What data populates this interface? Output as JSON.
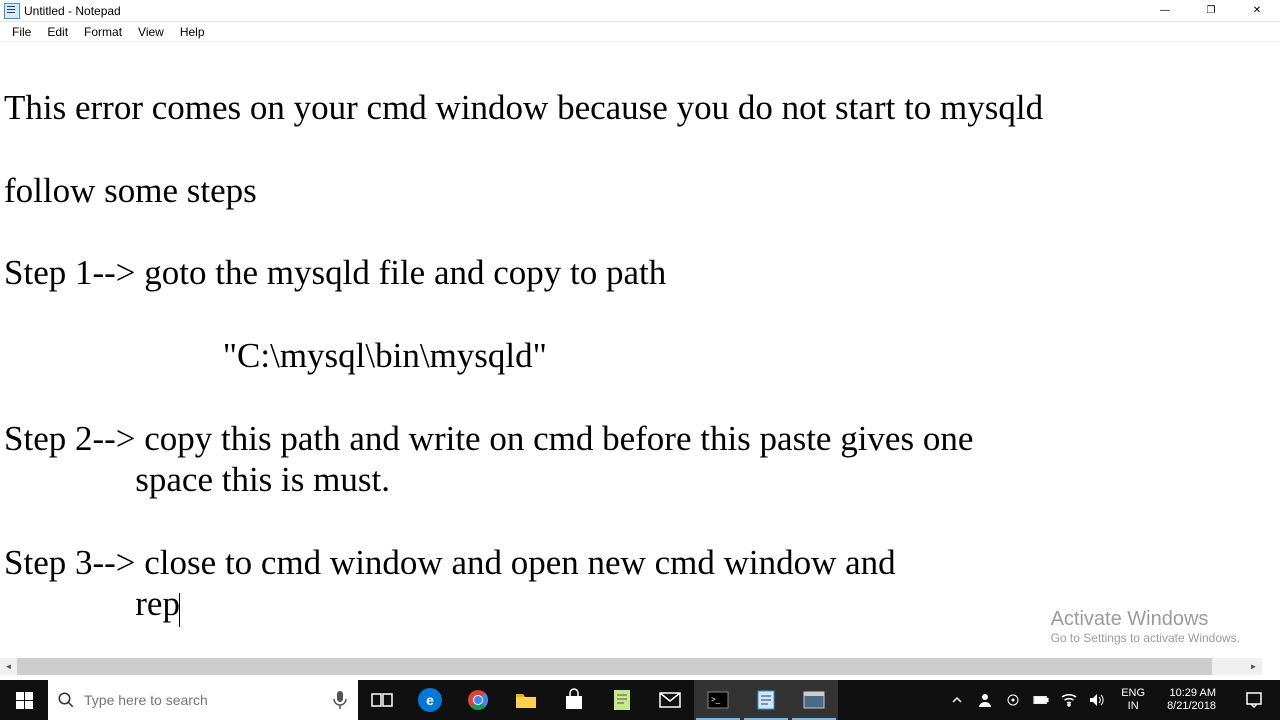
{
  "window": {
    "title": "Untitled - Notepad"
  },
  "menus": {
    "file": "File",
    "edit": "Edit",
    "format": "Format",
    "view": "View",
    "help": "Help"
  },
  "document": {
    "p1": "This error comes on your cmd window because you do not start to mysqld",
    "p2": "follow some steps",
    "p3": "Step 1--> goto the mysqld file and copy to path",
    "p4": "                         \"C:\\mysql\\bin\\mysqld\"",
    "p5": "Step 2--> copy this path and write on cmd before this paste gives one ",
    "p5b": "               space this is must.",
    "p6": "Step 3--> close to cmd window and open new cmd window and ",
    "p6b": "               rep"
  },
  "watermark": {
    "title": "Activate Windows",
    "sub": "Go to Settings to activate Windows."
  },
  "taskbar": {
    "search_placeholder": "Type here to search",
    "lang1": "ENG",
    "lang2": "IN",
    "time": "10:29 AM",
    "date": "8/21/2018"
  }
}
